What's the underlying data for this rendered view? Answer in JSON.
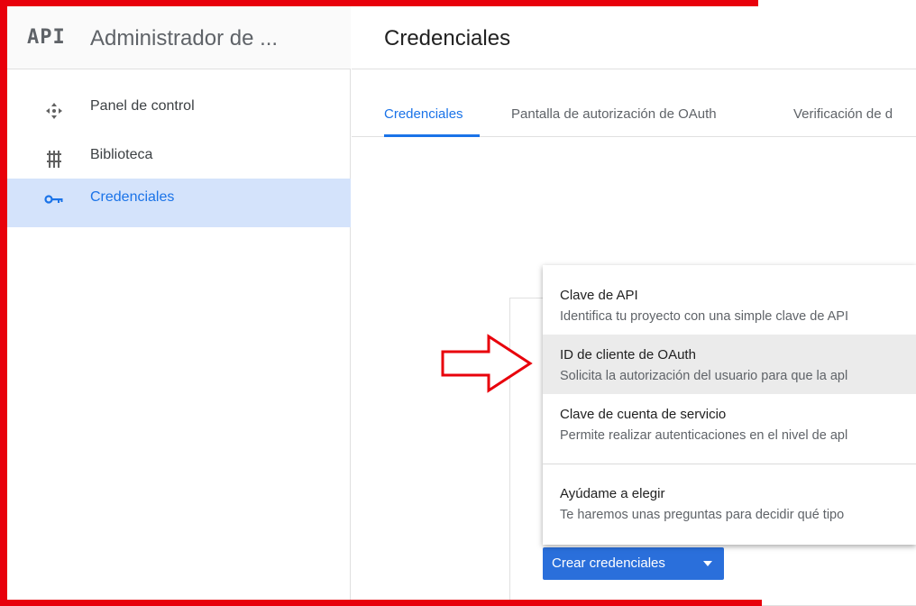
{
  "brand": {
    "logo": "API",
    "title": "Administrador de ..."
  },
  "sidebar": {
    "items": [
      {
        "label": "Panel de control",
        "icon": "dashboard-icon"
      },
      {
        "label": "Biblioteca",
        "icon": "library-icon"
      },
      {
        "label": "Credenciales",
        "icon": "key-icon",
        "active": true
      }
    ]
  },
  "page": {
    "title": "Credenciales"
  },
  "tabs": [
    {
      "label": "Credenciales",
      "active": true
    },
    {
      "label": "Pantalla de autorización de OAuth"
    },
    {
      "label": "Verificación de d"
    }
  ],
  "menu": {
    "items": [
      {
        "title": "Clave de API",
        "desc": "Identifica tu proyecto con una simple clave de API"
      },
      {
        "title": "ID de cliente de OAuth",
        "desc": "Solicita la autorización del usuario para que la apl",
        "highlighted": true
      },
      {
        "title": "Clave de cuenta de servicio",
        "desc": "Permite realizar autenticaciones en el nivel de apl"
      },
      {
        "title": "Ayúdame a elegir",
        "desc": "Te haremos unas preguntas para decidir qué tipo"
      }
    ]
  },
  "create_button": {
    "label": "Crear credenciales",
    "icon": "caret-down-icon"
  },
  "colors": {
    "accent": "#1a73e8",
    "button": "#2a6fdb",
    "annotation": "#e8000b",
    "active_nav_bg": "#d4e3fb"
  }
}
